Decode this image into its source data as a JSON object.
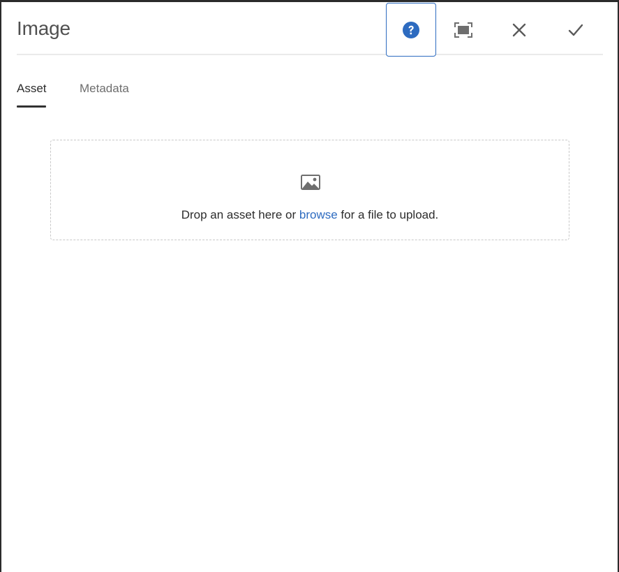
{
  "dialog": {
    "title": "Image",
    "buttons": {
      "help": "help-icon",
      "fullscreen": "fullscreen-icon",
      "close": "close-icon",
      "done": "checkmark-icon"
    }
  },
  "tabs": [
    {
      "label": "Asset",
      "active": true
    },
    {
      "label": "Metadata",
      "active": false
    }
  ],
  "dropzone": {
    "icon": "image-icon",
    "text_before": "Drop an asset here or ",
    "link_text": "browse",
    "text_after": " for a file to upload."
  },
  "colors": {
    "accent": "#2d6bc0",
    "title_text": "#505050",
    "body_text": "#2c2c2c",
    "inactive_tab": "#6e6e6e",
    "backdrop": "#2b2b2b"
  }
}
